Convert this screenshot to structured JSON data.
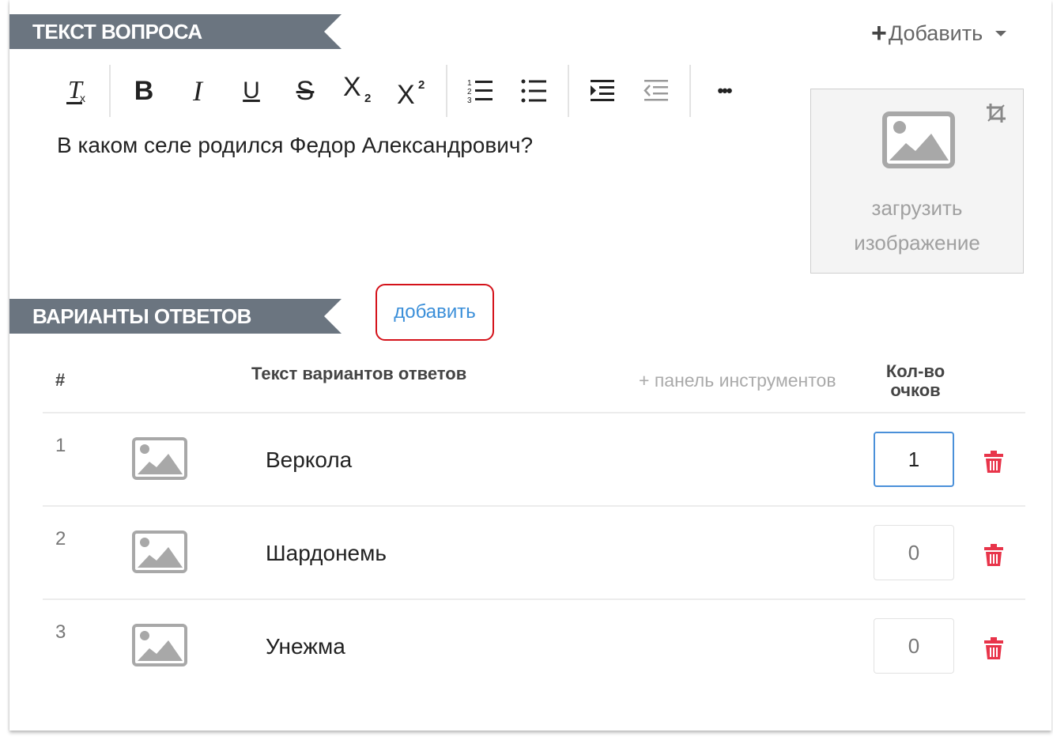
{
  "question_section": {
    "title": "ТЕКСТ ВОПРОСА",
    "add_menu_label": "Добавить",
    "question_text": "В каком селе родился Федор Александрович?",
    "image_upload_label_line1": "загрузить",
    "image_upload_label_line2": "изображение",
    "toolbar": {
      "bold": "B",
      "italic": "I",
      "underline": "U",
      "strike": "S",
      "more": "•••"
    }
  },
  "answers_section": {
    "title": "ВАРИАНТЫ ОТВЕТОВ",
    "add_label": "добавить",
    "columns": {
      "num": "#",
      "text": "Текст вариантов ответов",
      "toolbar_toggle": "+ панель инструментов",
      "points_line1": "Кол-во",
      "points_line2": "очков"
    },
    "rows": [
      {
        "num": "1",
        "text": "Веркола",
        "points": "1"
      },
      {
        "num": "2",
        "text": "Шардонемь",
        "points": "0"
      },
      {
        "num": "3",
        "text": "Унежма",
        "points": "0"
      }
    ]
  },
  "colors": {
    "ribbon": "#6b7580",
    "link": "#3b8fd9",
    "highlight_border": "#d4121a",
    "delete": "#e8344a",
    "focus_border": "#4a90d9"
  }
}
